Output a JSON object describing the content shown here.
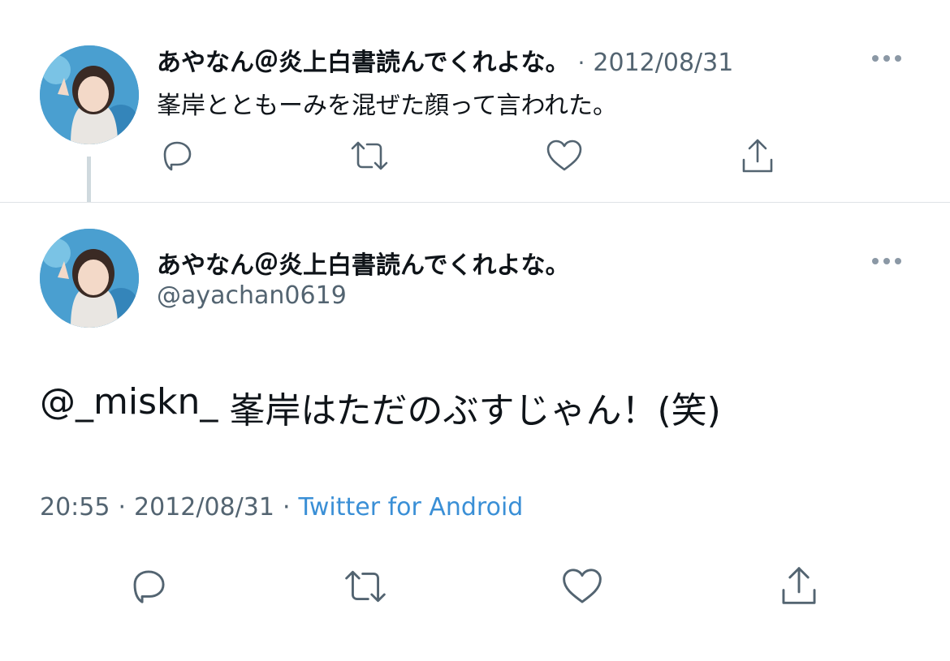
{
  "reply_tweet": {
    "display_name": "あやなん＠炎上白書読んでくれよな。",
    "separator_dot": "·",
    "date": "2012/08/31",
    "text": "峯岸とともーみを混ぜた顔って言われた。",
    "actions": [
      "reply-icon",
      "retweet-icon",
      "like-icon",
      "share-icon"
    ]
  },
  "main_tweet": {
    "display_name": "あやなん＠炎上白書読んでくれよな。",
    "handle": "@ayachan0619",
    "mention": "@_miskn_",
    "body": "峯岸はただのぶすじゃん！(笑)",
    "time": "20:55",
    "meta_dot_1": "·",
    "date": "2012/08/31",
    "meta_dot_2": "·",
    "source": "Twitter for Android",
    "actions": [
      "reply-icon",
      "retweet-icon",
      "like-icon",
      "share-icon"
    ]
  },
  "colors": {
    "text": "#0f1419",
    "secondary": "#536471",
    "link": "#3a8fd6",
    "divider": "#dfe3e6"
  }
}
